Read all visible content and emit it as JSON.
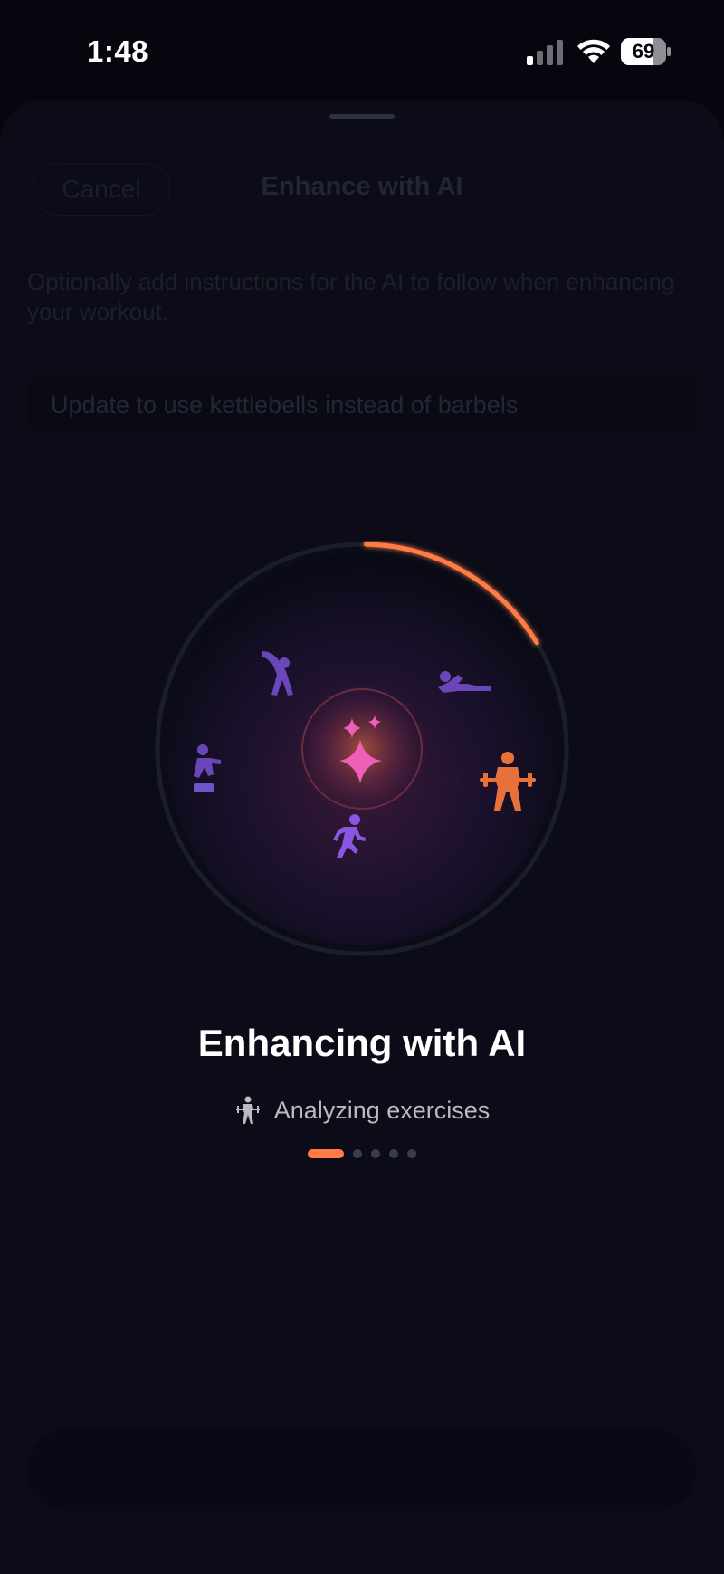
{
  "status_bar": {
    "time": "1:48",
    "battery": "69"
  },
  "sheet": {
    "cancel_label": "Cancel",
    "title": "Enhance with AI",
    "description": "Optionally add instructions for the AI to follow when enhancing your workout.",
    "instructions_value": "Update to use kettlebells instead of barbels"
  },
  "loading": {
    "title": "Enhancing with AI",
    "status": "Analyzing exercises",
    "progress": 0.16,
    "step": 1,
    "total_steps": 5,
    "icons": [
      "sparkles-icon",
      "stretching-icon",
      "floor-exercise-icon",
      "step-up-icon",
      "weightlifting-icon",
      "running-icon",
      "lift-icon"
    ]
  },
  "colors": {
    "accent": "#ff7b45",
    "ring_track": "#1b1e2a",
    "purple": "#7b4fd0",
    "pink": "#e95bd0",
    "background": "#05060e"
  }
}
